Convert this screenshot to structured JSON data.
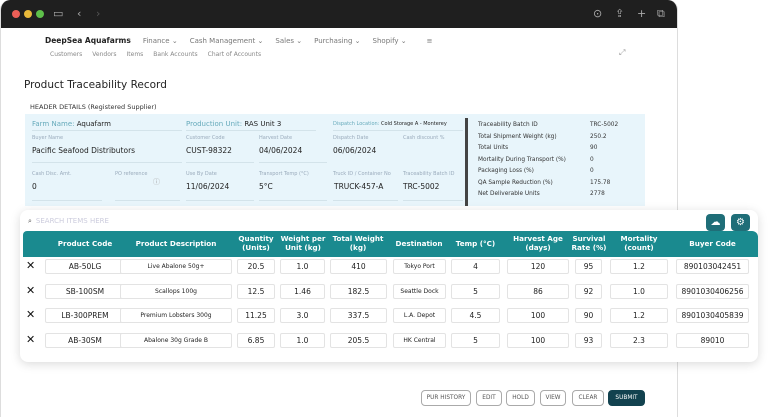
{
  "brand": "DeepSea Aquafarms",
  "nav": [
    "Finance",
    "Cash Management",
    "Sales",
    "Purchasing",
    "Shopify"
  ],
  "subnav": [
    "Customers",
    "Vendors",
    "Items",
    "Bank Accounts",
    "Chart of Accounts"
  ],
  "page_title": "Product Traceability Record",
  "header": {
    "title": "HEADER DETAILS (Registered Supplier)",
    "farm_label": "Farm Name:",
    "farm": "Aquafarm",
    "unit_label": "Production Unit:",
    "unit": "RAS Unit 3",
    "dispatch_loc_label": "Dispatch Location:",
    "dispatch_loc": "Cold Storage A - Monterey",
    "fields": [
      {
        "label": "Buyer Name",
        "value": "Pacific Seafood Distributors"
      },
      {
        "label": "Customer Code",
        "value": "CUST-98322"
      },
      {
        "label": "Harvest Date",
        "value": "04/06/2024"
      },
      {
        "label": "Dispatch Date",
        "value": "06/06/2024"
      },
      {
        "label": "Cash discount %",
        "value": ""
      },
      {
        "label": "Cash Disc. Amt.",
        "value": "0"
      },
      {
        "label": "PO reference",
        "value": ""
      },
      {
        "label": "Use By Date",
        "value": "11/06/2024"
      },
      {
        "label": "Transport Temp (°C)",
        "value": "5°C"
      },
      {
        "label": "Truck ID / Container No",
        "value": "TRUCK-457-A"
      },
      {
        "label": "Traceability Batch ID",
        "value": "TRC-5002"
      }
    ]
  },
  "summary": [
    {
      "label": "Traceability Batch ID",
      "value": "TRC-5002"
    },
    {
      "label": "Total Shipment Weight (kg)",
      "value": "250.2"
    },
    {
      "label": "Total Units",
      "value": "90"
    },
    {
      "label": "Mortality During Transport (%)",
      "value": "0"
    },
    {
      "label": "Packaging Loss (%)",
      "value": "0"
    },
    {
      "label": "QA Sample Reduction (%)",
      "value": "175.78"
    },
    {
      "label": "Net Deliverable Units",
      "value": "2778"
    }
  ],
  "search_placeholder": "SEARCH ITEMS HERE",
  "columns": [
    "Product Code",
    "Product Description",
    "Quantity (Units)",
    "Weight per Unit (kg)",
    "Total Weight (kg)",
    "Destination",
    "Temp (°C)",
    "Harvest Age (days)",
    "Survival Rate (%)",
    "Mortality (count)",
    "Buyer Code"
  ],
  "rows": [
    [
      "AB-50LG",
      "Live Abalone 50g+",
      "20.5",
      "1.0",
      "410",
      "Tokyo Port",
      "4",
      "120",
      "95",
      "1.2",
      "890103042451"
    ],
    [
      "SB-100SM",
      "Scallops 100g",
      "12.5",
      "1.46",
      "182.5",
      "Seattle Dock",
      "5",
      "86",
      "92",
      "1.0",
      "8901030406256"
    ],
    [
      "LB-300PREM",
      "Premium Lobsters 300g",
      "11.25",
      "3.0",
      "337.5",
      "L.A. Depot",
      "4.5",
      "100",
      "90",
      "1.2",
      "8901030405839"
    ],
    [
      "AB-30SM",
      "Abalone 30g Grade B",
      "6.85",
      "1.0",
      "205.5",
      "HK Central",
      "5",
      "100",
      "93",
      "2.3",
      "89010"
    ]
  ],
  "buttons": [
    "PUR HISTORY",
    "EDIT",
    "HOLD",
    "VIEW",
    "CLEAR",
    "SUBMIT"
  ],
  "colors": {
    "table_header": "#1a8a8f",
    "primary_button": "#12424f",
    "header_bg": "#e8f5fb"
  }
}
